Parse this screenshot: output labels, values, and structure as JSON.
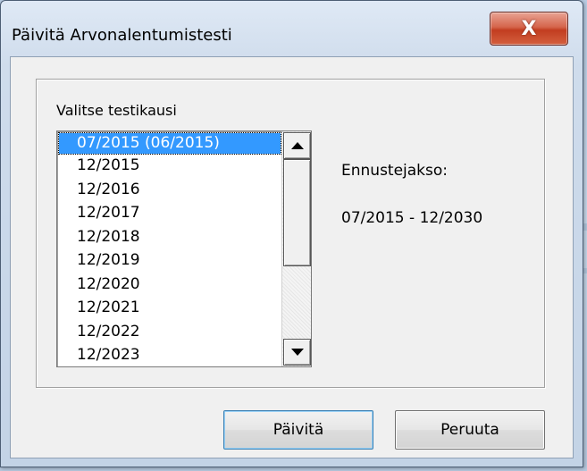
{
  "window": {
    "title": "Päivitä Arvonalentumistesti",
    "close_label": "X"
  },
  "test_period": {
    "label": "Valitse testikausi",
    "items": [
      "07/2015 (06/2015)",
      "12/2015",
      "12/2016",
      "12/2017",
      "12/2018",
      "12/2019",
      "12/2020",
      "12/2021",
      "12/2022",
      "12/2023"
    ],
    "selected_index": 0
  },
  "forecast": {
    "label": "Ennustejakso:",
    "value": "07/2015 - 12/2030"
  },
  "buttons": {
    "update_label": "Päivitä",
    "cancel_label": "Peruuta"
  },
  "colors": {
    "selection": "#3399ff",
    "close_button": "#c23d20"
  }
}
